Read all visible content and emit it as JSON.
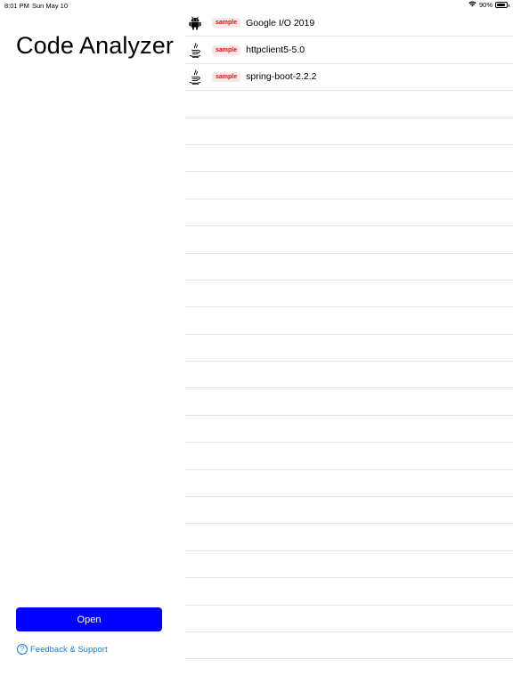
{
  "status_bar": {
    "time": "8:01 PM",
    "date": "Sun May 10",
    "battery": "90%",
    "battery_level": 0.9
  },
  "sidebar": {
    "title": "Code Analyzer",
    "open_label": "Open",
    "feedback_label": "Feedback & Support",
    "help_icon": "?"
  },
  "projects": [
    {
      "icon": "android-icon",
      "badge": "sample",
      "name": "Google I/O 2019"
    },
    {
      "icon": "java-icon",
      "badge": "sample",
      "name": "httpclient5-5.0"
    },
    {
      "icon": "java-icon",
      "badge": "sample",
      "name": "spring-boot-2.2.2"
    }
  ],
  "colors": {
    "accent": "#0000ff",
    "link": "#1c7cd5",
    "badge_text": "#e01010",
    "badge_bg": "#fde6e6"
  }
}
